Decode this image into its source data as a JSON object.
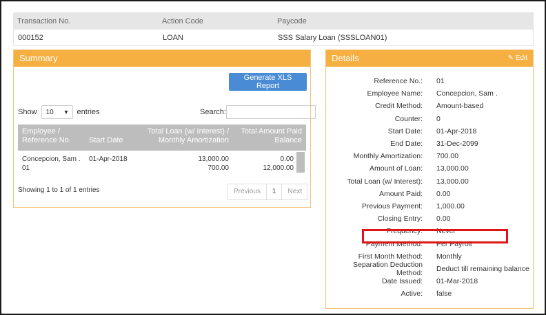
{
  "transaction": {
    "headers": [
      "Transaction No.",
      "Action Code",
      "Paycode"
    ],
    "values": [
      "000152",
      "LOAN",
      "SSS Salary Loan (SSSLOAN01)"
    ]
  },
  "summary": {
    "title": "Summary",
    "generate_button": "Generate XLS Report",
    "show_label": "Show",
    "page_size": "10",
    "entries_label": "entries",
    "search_label": "Search:",
    "columns": {
      "employee": [
        "Employee /",
        "Reference No."
      ],
      "start_date": "Start Date",
      "total_loan": [
        "Total Loan (w/ Interest) /",
        "Monthly Amortization"
      ],
      "total_paid": [
        "Total Amount Paid",
        "Balance"
      ]
    },
    "rows": [
      {
        "employee": "Concepcion, Sam .",
        "reference": "01",
        "start_date": "01-Apr-2018",
        "total_loan": "13,000.00",
        "monthly_amortization": "700.00",
        "total_paid": "0.00",
        "balance": "12,000.00"
      }
    ],
    "info": "Showing 1 to 1 of 1 entries",
    "pager": {
      "previous": "Previous",
      "current": "1",
      "next": "Next"
    }
  },
  "details": {
    "title": "Details",
    "edit_label": "Edit",
    "fields": [
      {
        "label": "Reference No.:",
        "value": "01"
      },
      {
        "label": "Employee Name:",
        "value": "Concepcion, Sam ."
      },
      {
        "label": "Credit Method:",
        "value": "Amount-based"
      },
      {
        "label": "Counter:",
        "value": "0"
      },
      {
        "label": "Start Date:",
        "value": "01-Apr-2018"
      },
      {
        "label": "End Date:",
        "value": "31-Dec-2099"
      },
      {
        "label": "Monthly Amortization:",
        "value": "700.00"
      },
      {
        "label": "Amount of Loan:",
        "value": "13,000.00"
      },
      {
        "label": "Total Loan (w/ Interest):",
        "value": "13,000.00"
      },
      {
        "label": "Amount Paid:",
        "value": "0.00"
      },
      {
        "label": "Previous Payment:",
        "value": "1,000.00"
      },
      {
        "label": "Closing Entry:",
        "value": "0.00"
      },
      {
        "label": "Frequency:",
        "value": "Never"
      },
      {
        "label": "Payment Method:",
        "value": "Per Payroll"
      },
      {
        "label": "First Month Method:",
        "value": "Monthly"
      },
      {
        "label": "Separation Deduction Method:",
        "value": "Deduct till remaining balance"
      },
      {
        "label": "Date Issued:",
        "value": "01-Mar-2018"
      },
      {
        "label": "Active:",
        "value": "false"
      }
    ]
  },
  "colors": {
    "panel_header": "#f5b041",
    "button_blue": "#4a8bd6",
    "highlight_red": "#e01414"
  }
}
